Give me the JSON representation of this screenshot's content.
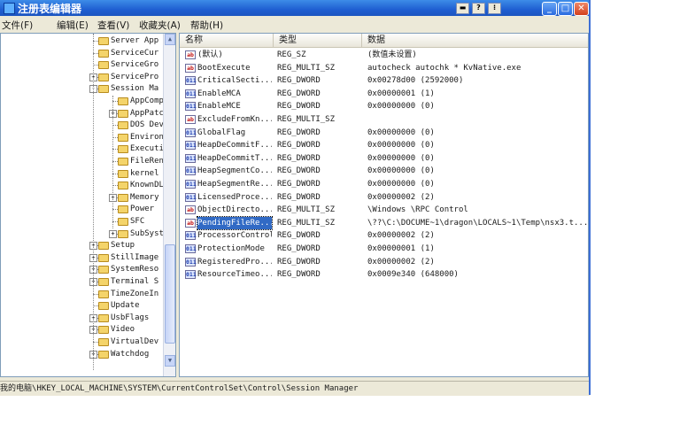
{
  "window": {
    "title": "注册表编辑器",
    "controls": {
      "minimize": "_",
      "maximize": "□",
      "close": "✕"
    },
    "mini_tools": [
      "▬",
      "?",
      "⁝"
    ]
  },
  "menu": [
    "文件(F)",
    "编辑(E)",
    "查看(V)",
    "收藏夹(A)",
    "帮助(H)"
  ],
  "tree": [
    {
      "label": "Server App",
      "level": 1,
      "expander": ""
    },
    {
      "label": "ServiceCur",
      "level": 1,
      "expander": ""
    },
    {
      "label": "ServiceGro",
      "level": 1,
      "expander": ""
    },
    {
      "label": "ServicePro",
      "level": 1,
      "expander": "+"
    },
    {
      "label": "Session Ma",
      "level": 1,
      "expander": "-"
    },
    {
      "label": "AppComp",
      "level": 2,
      "expander": ""
    },
    {
      "label": "AppPatc",
      "level": 2,
      "expander": "+"
    },
    {
      "label": "DOS Dev",
      "level": 2,
      "expander": ""
    },
    {
      "label": "Environ",
      "level": 2,
      "expander": ""
    },
    {
      "label": "Executi",
      "level": 2,
      "expander": ""
    },
    {
      "label": "FileRen",
      "level": 2,
      "expander": ""
    },
    {
      "label": "kernel",
      "level": 2,
      "expander": ""
    },
    {
      "label": "KnownDL",
      "level": 2,
      "expander": ""
    },
    {
      "label": "Memory",
      "level": 2,
      "expander": "+"
    },
    {
      "label": "Power",
      "level": 2,
      "expander": ""
    },
    {
      "label": "SFC",
      "level": 2,
      "expander": ""
    },
    {
      "label": "SubSyst",
      "level": 2,
      "expander": "+"
    },
    {
      "label": "Setup",
      "level": 1,
      "expander": "+"
    },
    {
      "label": "StillImage",
      "level": 1,
      "expander": "+"
    },
    {
      "label": "SystemReso",
      "level": 1,
      "expander": "+"
    },
    {
      "label": "Terminal S",
      "level": 1,
      "expander": "+"
    },
    {
      "label": "TimeZoneIn",
      "level": 1,
      "expander": ""
    },
    {
      "label": "Update",
      "level": 1,
      "expander": ""
    },
    {
      "label": "UsbFlags",
      "level": 1,
      "expander": "+"
    },
    {
      "label": "Video",
      "level": 1,
      "expander": "+"
    },
    {
      "label": "VirtualDev",
      "level": 1,
      "expander": ""
    },
    {
      "label": "Watchdog",
      "level": 1,
      "expander": "+"
    }
  ],
  "list": {
    "headers": [
      "名称",
      "类型",
      "数据"
    ],
    "rows": [
      {
        "icon": "ab",
        "name": "(默认)",
        "type": "REG_SZ",
        "data": "(数值未设置)"
      },
      {
        "icon": "ab",
        "name": "BootExecute",
        "type": "REG_MULTI_SZ",
        "data": "autocheck autochk * KvNative.exe"
      },
      {
        "icon": "bin",
        "name": "CriticalSecti...",
        "type": "REG_DWORD",
        "data": "0x00278d00 (2592000)"
      },
      {
        "icon": "bin",
        "name": "EnableMCA",
        "type": "REG_DWORD",
        "data": "0x00000001 (1)"
      },
      {
        "icon": "bin",
        "name": "EnableMCE",
        "type": "REG_DWORD",
        "data": "0x00000000 (0)"
      },
      {
        "icon": "ab",
        "name": "ExcludeFromKn...",
        "type": "REG_MULTI_SZ",
        "data": ""
      },
      {
        "icon": "bin",
        "name": "GlobalFlag",
        "type": "REG_DWORD",
        "data": "0x00000000 (0)"
      },
      {
        "icon": "bin",
        "name": "HeapDeCommitF...",
        "type": "REG_DWORD",
        "data": "0x00000000 (0)"
      },
      {
        "icon": "bin",
        "name": "HeapDeCommitT...",
        "type": "REG_DWORD",
        "data": "0x00000000 (0)"
      },
      {
        "icon": "bin",
        "name": "HeapSegmentCo...",
        "type": "REG_DWORD",
        "data": "0x00000000 (0)"
      },
      {
        "icon": "bin",
        "name": "HeapSegmentRe...",
        "type": "REG_DWORD",
        "data": "0x00000000 (0)"
      },
      {
        "icon": "bin",
        "name": "LicensedProce...",
        "type": "REG_DWORD",
        "data": "0x00000002 (2)"
      },
      {
        "icon": "ab",
        "name": "ObjectDirecto...",
        "type": "REG_MULTI_SZ",
        "data": "\\Windows \\RPC Control"
      },
      {
        "icon": "ab",
        "name": "PendingFileRe...",
        "type": "REG_MULTI_SZ",
        "data": "\\??\\C:\\DOCUME~1\\dragon\\LOCALS~1\\Temp\\nsx3.t...",
        "selected": true
      },
      {
        "icon": "bin",
        "name": "ProcessorControl",
        "type": "REG_DWORD",
        "data": "0x00000002 (2)"
      },
      {
        "icon": "bin",
        "name": "ProtectionMode",
        "type": "REG_DWORD",
        "data": "0x00000001 (1)"
      },
      {
        "icon": "bin",
        "name": "RegisteredPro...",
        "type": "REG_DWORD",
        "data": "0x00000002 (2)"
      },
      {
        "icon": "bin",
        "name": "ResourceTimeo...",
        "type": "REG_DWORD",
        "data": "0x0009e340 (648000)"
      }
    ]
  },
  "status": {
    "path": "我的电脑\\HKEY_LOCAL_MACHINE\\SYSTEM\\CurrentControlSet\\Control\\Session Manager"
  },
  "icons": {
    "string_value": "ab",
    "binary_value": "011"
  },
  "colors": {
    "title_blue": "#1f5fd1",
    "selection": "#316ac5",
    "window_bg": "#ece9d8"
  }
}
